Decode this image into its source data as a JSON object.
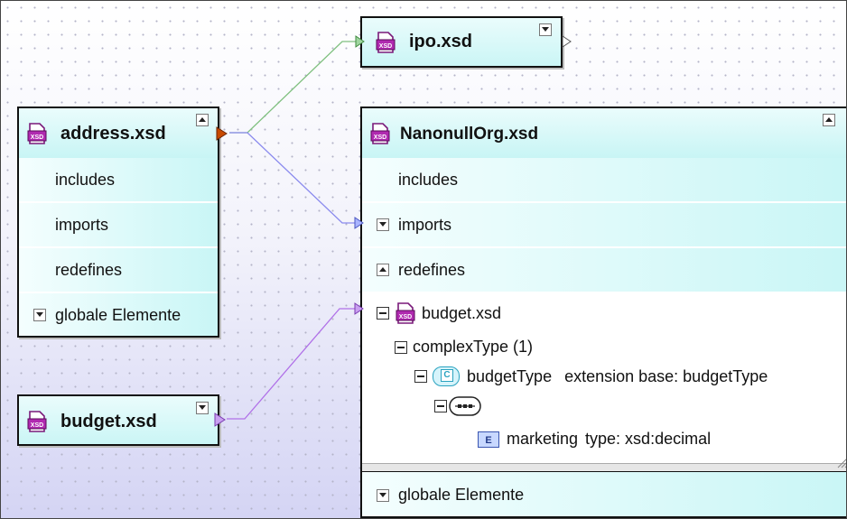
{
  "boxes": {
    "address": {
      "title": "address.xsd",
      "rows": [
        "includes",
        "imports",
        "redefines",
        "globale Elemente"
      ]
    },
    "ipo": {
      "title": "ipo.xsd"
    },
    "budget": {
      "title": "budget.xsd"
    },
    "nanonull": {
      "title": "NanonullOrg.xsd",
      "rows": {
        "includes": "includes",
        "imports": "imports",
        "redefines": "redefines"
      },
      "tree": {
        "file": "budget.xsd",
        "complex_type": "complexType (1)",
        "type_name": "budgetType",
        "extension": "extension base: budgetType",
        "element": "marketing",
        "element_type": "type: xsd:decimal"
      },
      "footer": "globale Elemente"
    }
  },
  "icons": {
    "xsd_file": "xsd-file-icon",
    "complex_type": "complex-type-icon",
    "sequence": "sequence-icon",
    "element": "element-icon"
  },
  "badges": {
    "complex_type": "C",
    "element": "E",
    "xsd": "XSD"
  },
  "colors": {
    "header_cyan": "#c8f5f5",
    "wire_green": "#6fbf6f",
    "wire_blue": "#8080ee",
    "wire_purple": "#b06ee8",
    "connector_orange": "#c84a00"
  }
}
